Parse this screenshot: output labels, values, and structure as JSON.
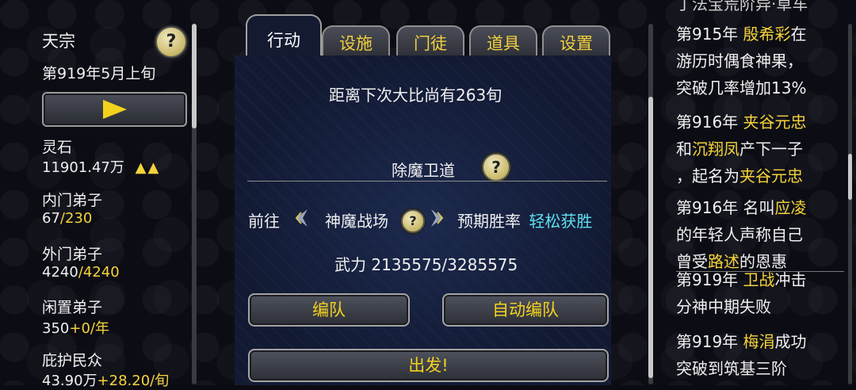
{
  "left_panel": {
    "sect_name": "天宗",
    "date": "第919年5月上旬",
    "help_symbol": "?",
    "spirit_stone_label": "灵石",
    "spirit_stone_value": "11901.47万",
    "spirit_stone_trend": "▲▲",
    "inner_disciples_label": "内门弟子",
    "inner_disciples_count": "67",
    "inner_disciples_max": "/230",
    "outer_disciples_label": "外门弟子",
    "outer_disciples_count": "4240",
    "outer_disciples_max": "/4240",
    "idle_disciples_label": "闲置弟子",
    "idle_disciples_count": "350",
    "idle_disciples_rate": "+0/年",
    "protected_people_label": "庇护民众",
    "protected_people_count": "43.90万",
    "protected_people_rate": "+28.20/旬"
  },
  "tabs": [
    {
      "label": "行动",
      "active": true
    },
    {
      "label": "设施",
      "active": false
    },
    {
      "label": "门徒",
      "active": false
    },
    {
      "label": "道具",
      "active": false
    },
    {
      "label": "设置",
      "active": false
    }
  ],
  "center": {
    "countdown_text": "距离下次大比尚有263旬",
    "section_title": "除魔卫道",
    "help_symbol": "?",
    "goto_label": "前往",
    "destination": "神魔战场",
    "win_rate_label": "预期胜率",
    "win_rate_value": "轻松获胜",
    "power_text": "武力 2135575/3285575",
    "team_button": "编队",
    "auto_team_button": "自动编队",
    "depart_button": "出发!"
  },
  "event_log": {
    "top_cut_line": "丁法宝荒阶异·草车",
    "entries": [
      {
        "lines": [
          [
            "第915年 ",
            "殷希彩",
            "在"
          ],
          [
            "游历时偶食神果，"
          ],
          [
            "突破几率增加13%"
          ]
        ]
      },
      {
        "lines": [
          [
            "第916年 ",
            "夹谷元忠"
          ],
          [
            "和",
            "沉翔凤",
            "产下一子"
          ],
          [
            "，起名为",
            "夹谷元忠"
          ]
        ]
      },
      {
        "lines": [
          [
            "第916年 名叫",
            "应凌"
          ],
          [
            "的年轻人声称自己"
          ],
          [
            "曾受",
            "路述",
            "的恩惠"
          ]
        ]
      },
      {
        "lines": [
          [
            "第919年 ",
            "卫战",
            "冲击"
          ],
          [
            "分神中期失败"
          ]
        ]
      },
      {
        "lines": [
          [
            "第919年 ",
            "梅涓",
            "成功"
          ],
          [
            "突破到筑基三阶"
          ]
        ]
      }
    ]
  },
  "colors": {
    "highlight_yellow": "#f5d33a",
    "win_cyan": "#5fe0f0",
    "panel_blue": "#121a33"
  }
}
